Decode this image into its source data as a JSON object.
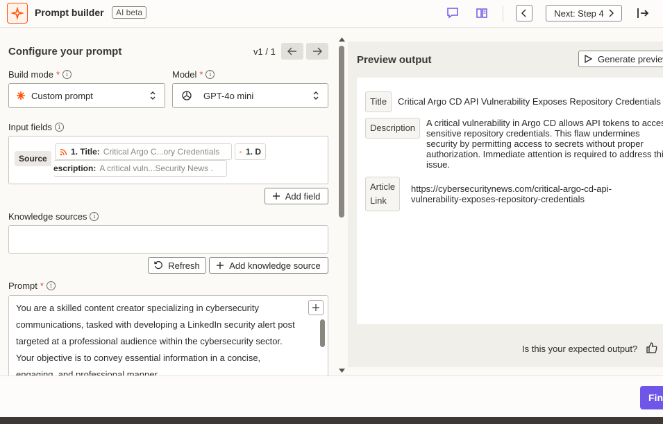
{
  "header": {
    "app_title": "Prompt builder",
    "badge": "AI beta",
    "next_label": "Next: Step 4",
    "icons": [
      "logo-sparkle-icon",
      "comment-icon",
      "book-icon",
      "chevron-left-icon",
      "chevron-right-icon",
      "exit-icon"
    ],
    "accent": "#ff4f00"
  },
  "configure": {
    "title": "Configure your prompt",
    "version": "v1 / 1",
    "build_mode": {
      "label": "Build mode",
      "value": "Custom prompt"
    },
    "model": {
      "label": "Model",
      "value": "GPT-4o mini"
    },
    "input_fields": {
      "label": "Input fields",
      "source_label": "Source",
      "pills": [
        {
          "num": "1. Title:",
          "text": "Critical Argo C...ory Credentials"
        },
        {
          "num": "1. D",
          "text": ""
        },
        {
          "num": "escription:",
          "text": "A critical vuln...Security News ."
        }
      ],
      "add_field": "Add field"
    },
    "knowledge": {
      "label": "Knowledge sources",
      "refresh": "Refresh",
      "add_source": "Add knowledge source"
    },
    "prompt": {
      "label": "Prompt",
      "lines": [
        "You are a skilled content creator specializing in cybersecurity",
        "communications, tasked with developing a LinkedIn security alert post",
        "targeted at a professional audience within the cybersecurity sector.",
        "Your objective is to convey essential information in a concise,",
        "engaging, and professional manner."
      ]
    }
  },
  "preview": {
    "title": "Preview output",
    "generate": "Generate preview",
    "rows": [
      {
        "key": "Title",
        "value": "Critical Argo CD API Vulnerability Exposes Repository Credentials"
      },
      {
        "key": "Description",
        "lines": [
          "A critical vulnerability in Argo CD allows API tokens to access",
          "sensitive repository credentials. This flaw undermines",
          "security by permitting access to secrets without proper",
          "authorization. Immediate attention is required to address this",
          "issue."
        ]
      },
      {
        "key_lines": [
          "Article",
          "Link"
        ],
        "lines": [
          "https://cybersecuritynews.com/critical-argo-cd-api-",
          "vulnerability-exposes-repository-credentials"
        ]
      }
    ],
    "expected": "Is this your expected output?"
  },
  "footer": {
    "finish": "Finish",
    "accent": "#6f56e8"
  }
}
